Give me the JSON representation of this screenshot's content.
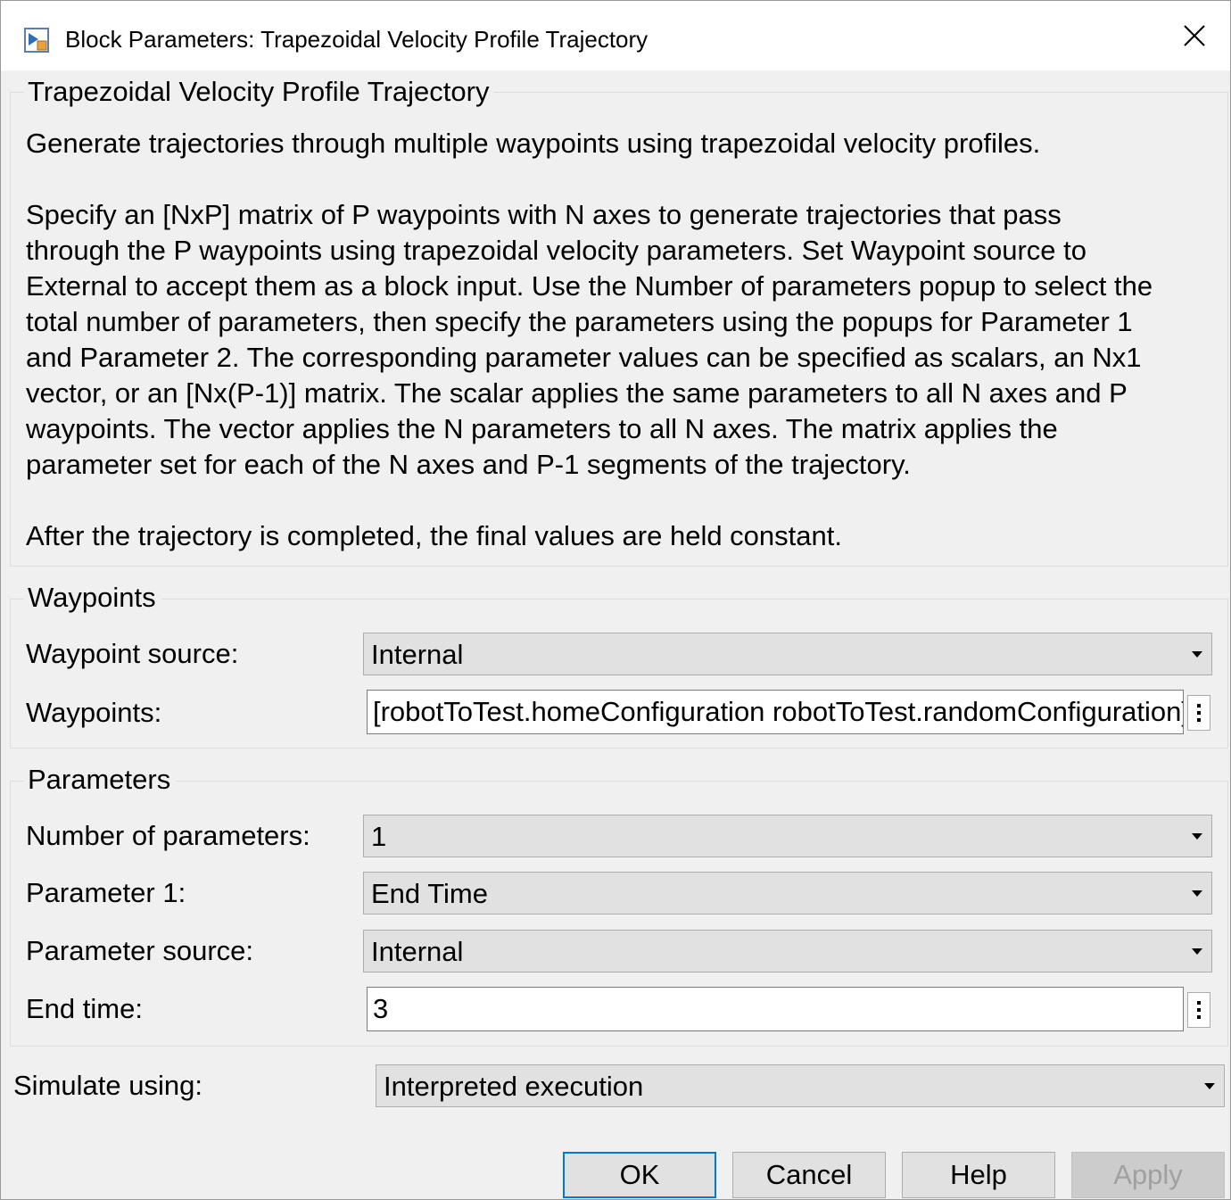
{
  "window": {
    "title": "Block Parameters: Trapezoidal Velocity Profile Trajectory"
  },
  "description": {
    "legend": "Trapezoidal Velocity Profile Trajectory",
    "lines": [
      "Generate trajectories through multiple waypoints using trapezoidal velocity profiles.",
      "",
      "Specify an [NxP] matrix of P waypoints with N axes to generate trajectories that pass",
      "through the P waypoints using trapezoidal velocity parameters. Set Waypoint source to",
      "External to accept them as a block input. Use the Number of parameters popup to select the",
      "total number of parameters, then specify the parameters using the popups for Parameter 1",
      "and Parameter 2. The corresponding parameter values can be specified as scalars, an Nx1",
      "vector, or an [Nx(P-1)] matrix. The scalar applies the same parameters to all N axes and P",
      "waypoints. The vector applies the N parameters to all N axes. The matrix applies the",
      "parameter set for each of the N axes and P-1 segments of the trajectory.",
      "",
      "After the trajectory is completed, the final values are held constant."
    ]
  },
  "waypoints": {
    "legend": "Waypoints",
    "source_label": "Waypoint source:",
    "source_value": "Internal",
    "waypoints_label": "Waypoints:",
    "waypoints_value": "[robotToTest.homeConfiguration robotToTest.randomConfiguration]"
  },
  "parameters": {
    "legend": "Parameters",
    "num_label": "Number of parameters:",
    "num_value": "1",
    "param1_label": "Parameter 1:",
    "param1_value": "End Time",
    "source_label": "Parameter source:",
    "source_value": "Internal",
    "endtime_label": "End time:",
    "endtime_value": "3"
  },
  "simulate": {
    "label": "Simulate using:",
    "value": "Interpreted execution"
  },
  "buttons": {
    "ok": "OK",
    "cancel": "Cancel",
    "help": "Help",
    "apply": "Apply"
  }
}
